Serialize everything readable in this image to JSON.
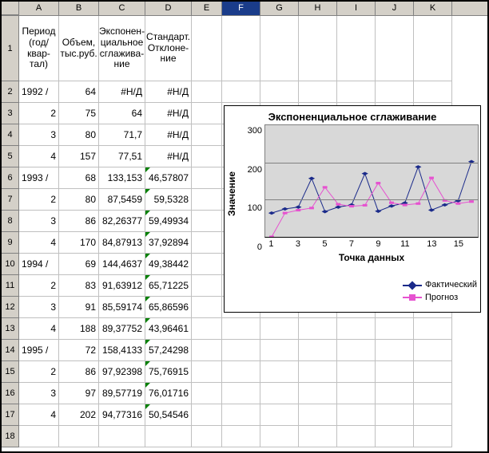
{
  "columns": [
    "A",
    "B",
    "C",
    "D",
    "E",
    "F",
    "G",
    "H",
    "I",
    "J",
    "K"
  ],
  "selected_column": "F",
  "headers": {
    "A": "Период (год/квар-тал)",
    "B": "Объем, тыс.руб.",
    "C": "Экспонен-циальное сглажива-ние",
    "D": "Стандарт. Отклоне-ние"
  },
  "rows": [
    {
      "n": "2",
      "a": "1992 /",
      "b": "64",
      "c": "#Н/Д",
      "d": "#Н/Д"
    },
    {
      "n": "3",
      "a": "2",
      "b": "75",
      "c": "64",
      "d": "#Н/Д"
    },
    {
      "n": "4",
      "a": "3",
      "b": "80",
      "c": "71,7",
      "d": "#Н/Д"
    },
    {
      "n": "5",
      "a": "4",
      "b": "157",
      "c": "77,51",
      "d": "#Н/Д"
    },
    {
      "n": "6",
      "a": "1993 /",
      "b": "68",
      "c": "133,153",
      "d": "46,57807",
      "tri": true
    },
    {
      "n": "7",
      "a": "2",
      "b": "80",
      "c": "87,5459",
      "d": "59,5328",
      "tri": true
    },
    {
      "n": "8",
      "a": "3",
      "b": "86",
      "c": "82,26377",
      "d": "59,49934",
      "tri": true
    },
    {
      "n": "9",
      "a": "4",
      "b": "170",
      "c": "84,87913",
      "d": "37,92894",
      "tri": true
    },
    {
      "n": "10",
      "a": "1994 /",
      "b": "69",
      "c": "144,4637",
      "d": "49,38442",
      "tri": true
    },
    {
      "n": "11",
      "a": "2",
      "b": "83",
      "c": "91,63912",
      "d": "65,71225",
      "tri": true
    },
    {
      "n": "12",
      "a": "3",
      "b": "91",
      "c": "85,59174",
      "d": "65,86596",
      "tri": true
    },
    {
      "n": "13",
      "a": "4",
      "b": "188",
      "c": "89,37752",
      "d": "43,96461",
      "tri": true
    },
    {
      "n": "14",
      "a": "1995 /",
      "b": "72",
      "c": "158,4133",
      "d": "57,24298",
      "tri": true
    },
    {
      "n": "15",
      "a": "2",
      "b": "86",
      "c": "97,92398",
      "d": "75,76915",
      "tri": true
    },
    {
      "n": "16",
      "a": "3",
      "b": "97",
      "c": "89,57719",
      "d": "76,01716",
      "tri": true
    },
    {
      "n": "17",
      "a": "4",
      "b": "202",
      "c": "94,77316",
      "d": "50,54546",
      "tri": true
    },
    {
      "n": "18",
      "a": "",
      "b": "",
      "c": "",
      "d": ""
    }
  ],
  "chart_data": {
    "type": "line",
    "title": "Экспоненциальное сглаживание",
    "xlabel": "Точка данных",
    "ylabel": "Значение",
    "ylim": [
      0,
      300
    ],
    "y_ticks": [
      0,
      100,
      200,
      300
    ],
    "x": [
      1,
      2,
      3,
      4,
      5,
      6,
      7,
      8,
      9,
      10,
      11,
      12,
      13,
      14,
      15,
      16
    ],
    "x_tick_labels": [
      "1",
      "",
      "3",
      "",
      "5",
      "",
      "7",
      "",
      "9",
      "",
      "11",
      "",
      "13",
      "",
      "15",
      ""
    ],
    "series": [
      {
        "name": "Фактический",
        "color": "#1a2a8a",
        "marker": "diamond",
        "values": [
          64,
          75,
          80,
          157,
          68,
          80,
          86,
          170,
          69,
          83,
          91,
          188,
          72,
          86,
          97,
          202
        ]
      },
      {
        "name": "Прогноз",
        "color": "#e652d0",
        "marker": "square",
        "values": [
          0,
          64,
          71.7,
          77.5,
          133.2,
          87.5,
          82.3,
          84.9,
          144.5,
          91.6,
          85.6,
          89.4,
          158.4,
          97.9,
          89.6,
          94.8
        ]
      }
    ],
    "legend": [
      "Фактический",
      "Прогноз"
    ]
  }
}
